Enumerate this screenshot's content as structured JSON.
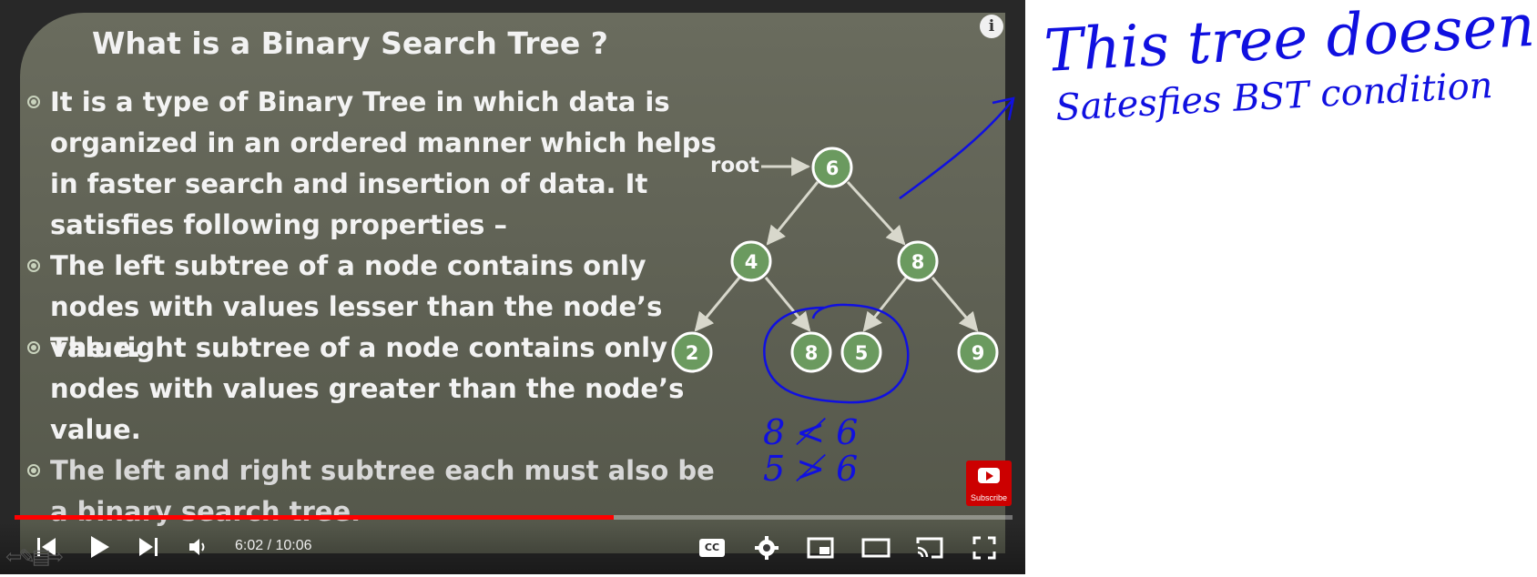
{
  "slide": {
    "title": "What is a Binary Search Tree ?",
    "bullets": [
      "It is a type of Binary Tree in which data is organized in an ordered manner which helps in faster search and insertion of data. It satisfies following properties –",
      "The left subtree of a node contains only nodes with values lesser than the node’s value.",
      "The right subtree of a node contains only nodes with values greater than the node’s value.",
      "The left and right subtree each must also be a binary search tree."
    ],
    "tree": {
      "root_label": "root",
      "nodes": [
        "6",
        "4",
        "8",
        "2",
        "8",
        "5",
        "9"
      ]
    }
  },
  "annotations": {
    "note_line1": "This tree doesent",
    "note_line2": "Satesfies BST condition",
    "ineq1": "8 ≮ 6",
    "ineq2": "5 ≯ 6"
  },
  "player": {
    "time": "6:02 / 10:06",
    "progress_fraction": 0.6,
    "subscribe_label": "Subscribe",
    "info_glyph": "i",
    "icons": [
      "skip-previous-icon",
      "play-icon",
      "skip-next-icon",
      "volume-icon",
      "captions-icon",
      "settings-icon",
      "miniplayer-icon",
      "theater-mode-icon",
      "cast-icon",
      "fullscreen-icon"
    ],
    "cc_label": "CC"
  },
  "colors": {
    "node_fill": "#6b9a5f",
    "progress": "#ff0000",
    "ink": "#1010e0"
  }
}
